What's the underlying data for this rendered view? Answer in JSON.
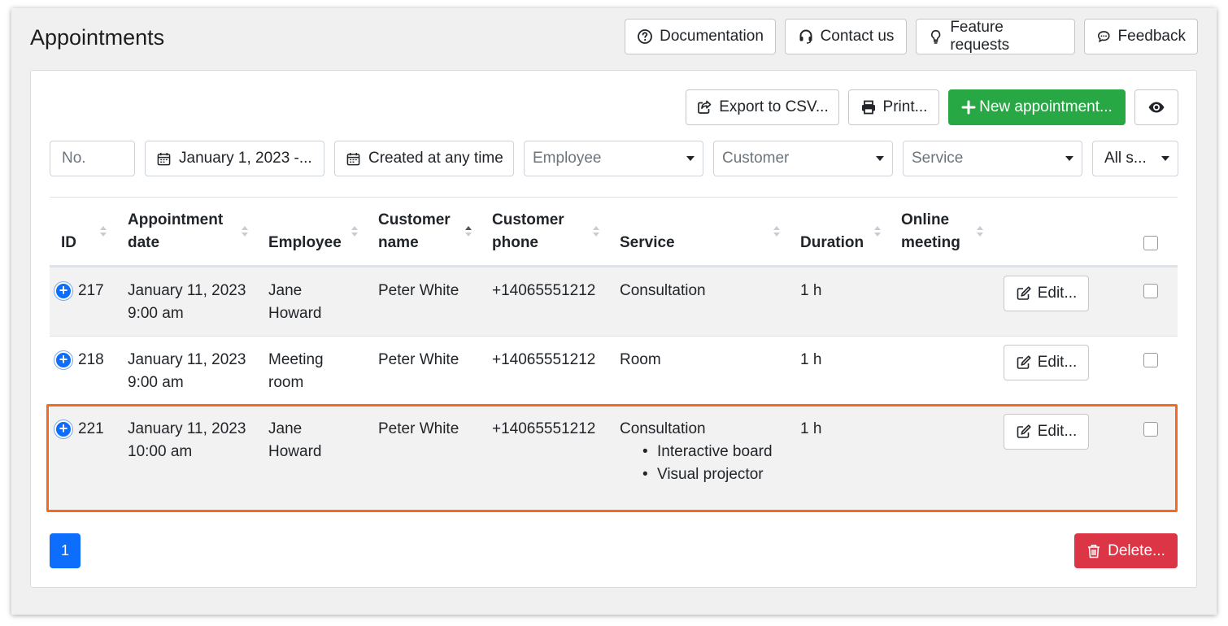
{
  "header": {
    "title": "Appointments",
    "buttons": {
      "documentation": "Documentation",
      "contact": "Contact us",
      "feature_requests": "Feature requests",
      "feedback": "Feedback"
    }
  },
  "toolbar": {
    "export": "Export to CSV...",
    "print": "Print...",
    "new": "New appointment...",
    "visibility_icon": "eye-icon"
  },
  "filters": {
    "number_placeholder": "No.",
    "date_range": "January 1, 2023 -...",
    "created": "Created at any time",
    "employee": "Employee",
    "customer": "Customer",
    "service": "Service",
    "status": "All s..."
  },
  "table": {
    "columns": {
      "id": "ID",
      "date_1": "Appointment",
      "date_2": "date",
      "employee": "Employee",
      "customer_1": "Customer",
      "customer_2": "name",
      "phone_1": "Customer",
      "phone_2": "phone",
      "service": "Service",
      "duration": "Duration",
      "online_1": "Online",
      "online_2": "meeting"
    },
    "rows": [
      {
        "id": "217",
        "date_1": "January 11, 2023",
        "date_2": "9:00 am",
        "employee_1": "Jane",
        "employee_2": "Howard",
        "customer": "Peter White",
        "phone": "+14065551212",
        "service": "Consultation",
        "extras": [],
        "duration": "1 h",
        "edit": "Edit..."
      },
      {
        "id": "218",
        "date_1": "January 11, 2023",
        "date_2": "9:00 am",
        "employee_1": "Meeting",
        "employee_2": "room",
        "customer": "Peter White",
        "phone": "+14065551212",
        "service": "Room",
        "extras": [],
        "duration": "1 h",
        "edit": "Edit..."
      },
      {
        "id": "221",
        "date_1": "January 11, 2023",
        "date_2": "10:00 am",
        "employee_1": "Jane",
        "employee_2": "Howard",
        "customer": "Peter White",
        "phone": "+14065551212",
        "service": "Consultation",
        "extras": [
          "Interactive board",
          "Visual projector"
        ],
        "duration": "1 h",
        "edit": "Edit..."
      }
    ]
  },
  "pagination": {
    "current": "1"
  },
  "footer": {
    "delete": "Delete..."
  },
  "colors": {
    "primary": "#0d6efd",
    "success": "#28a745",
    "danger": "#dc3545",
    "highlight": "#f26b21"
  }
}
